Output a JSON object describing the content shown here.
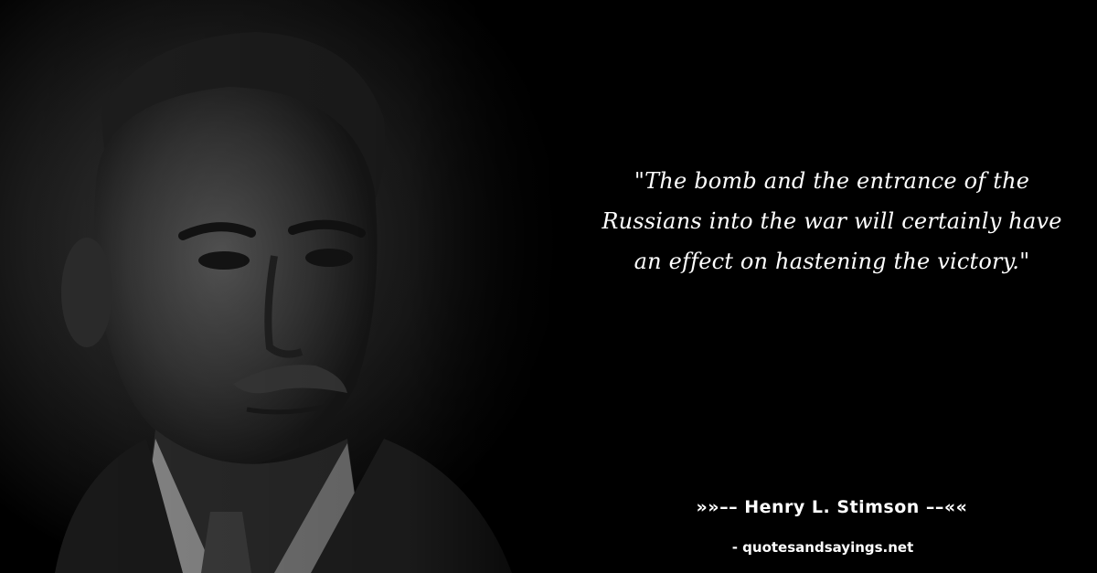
{
  "quote": {
    "text": "\"The bomb and the entrance of the Russians into the war will certainly have an effect on hastening the victory.\""
  },
  "attribution": {
    "author_line": "»»–– Henry L. Stimson ––««"
  },
  "source": {
    "site_line": "- quotesandsayings.net"
  },
  "colors": {
    "background": "#000000",
    "text": "#ffffff"
  }
}
